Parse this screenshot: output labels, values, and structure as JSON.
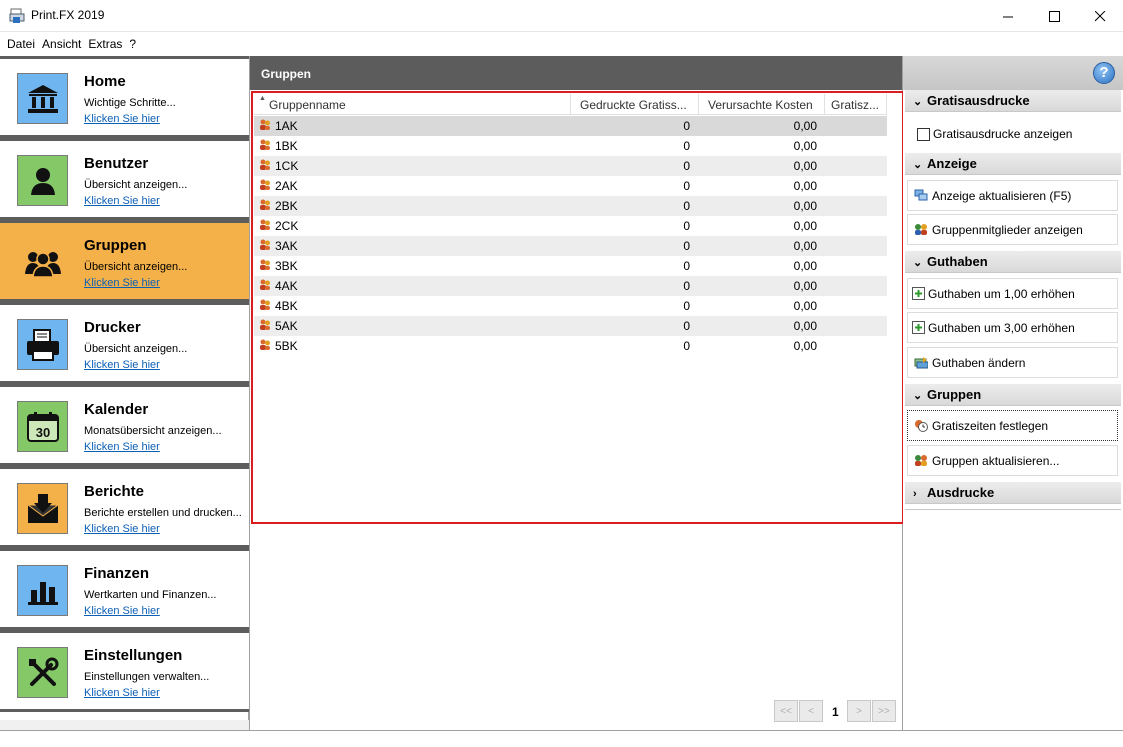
{
  "window": {
    "title": "Print.FX 2019"
  },
  "menu": [
    "Datei",
    "Ansicht",
    "Extras",
    "?"
  ],
  "nav": [
    {
      "title": "Home",
      "desc": "Wichtige Schritte...",
      "link": "Klicken Sie hier",
      "icon": "bank-icon"
    },
    {
      "title": "Benutzer",
      "desc": "Übersicht anzeigen...",
      "link": "Klicken Sie hier",
      "icon": "user-icon"
    },
    {
      "title": "Gruppen",
      "desc": "Übersicht anzeigen...",
      "link": "Klicken Sie hier",
      "icon": "group-icon"
    },
    {
      "title": "Drucker",
      "desc": "Übersicht anzeigen...",
      "link": "Klicken Sie hier",
      "icon": "printer-icon"
    },
    {
      "title": "Kalender",
      "desc": "Monatsübersicht anzeigen...",
      "link": "Klicken Sie hier",
      "icon": "calendar-icon",
      "calendar_day": "30"
    },
    {
      "title": "Berichte",
      "desc": "Berichte erstellen und drucken...",
      "link": "Klicken Sie hier",
      "icon": "report-icon"
    },
    {
      "title": "Finanzen",
      "desc": "Wertkarten und Finanzen...",
      "link": "Klicken Sie hier",
      "icon": "chart-icon"
    },
    {
      "title": "Einstellungen",
      "desc": "Einstellungen verwalten...",
      "link": "Klicken Sie hier",
      "icon": "tools-icon"
    }
  ],
  "active_nav": "Gruppen",
  "main": {
    "header": "Gruppen",
    "columns": [
      "Gruppenname",
      "Gedruckte Gratiss...",
      "Verursachte Kosten",
      "Gratisz..."
    ],
    "rows": [
      {
        "name": "1AK",
        "printed": "0",
        "cost": "0,00"
      },
      {
        "name": "1BK",
        "printed": "0",
        "cost": "0,00"
      },
      {
        "name": "1CK",
        "printed": "0",
        "cost": "0,00"
      },
      {
        "name": "2AK",
        "printed": "0",
        "cost": "0,00"
      },
      {
        "name": "2BK",
        "printed": "0",
        "cost": "0,00"
      },
      {
        "name": "2CK",
        "printed": "0",
        "cost": "0,00"
      },
      {
        "name": "3AK",
        "printed": "0",
        "cost": "0,00"
      },
      {
        "name": "3BK",
        "printed": "0",
        "cost": "0,00"
      },
      {
        "name": "4AK",
        "printed": "0",
        "cost": "0,00"
      },
      {
        "name": "4BK",
        "printed": "0",
        "cost": "0,00"
      },
      {
        "name": "5AK",
        "printed": "0",
        "cost": "0,00"
      },
      {
        "name": "5BK",
        "printed": "0",
        "cost": "0,00"
      }
    ],
    "pager": {
      "first": "<<",
      "prev": "<",
      "page": "1",
      "next": ">",
      "last": ">>"
    }
  },
  "right": {
    "help": "?",
    "sections": {
      "gratis": {
        "title": "Gratisausdrucke",
        "checkbox_label": "Gratisausdrucke anzeigen",
        "checked": false
      },
      "anzeige": {
        "title": "Anzeige",
        "buttons": [
          "Anzeige aktualisieren (F5)",
          "Gruppenmitglieder anzeigen"
        ]
      },
      "guthaben": {
        "title": "Guthaben",
        "buttons": [
          "Guthaben um 1,00 erhöhen",
          "Guthaben um 3,00 erhöhen",
          "Guthaben ändern"
        ]
      },
      "gruppen": {
        "title": "Gruppen",
        "buttons": [
          "Gratiszeiten festlegen",
          "Gruppen aktualisieren..."
        ]
      },
      "ausdrucke": {
        "title": "Ausdrucke"
      }
    }
  },
  "colors": {
    "active_nav": "#f5b149",
    "header_dark": "#5c5c5c",
    "selection_border": "#d81e1e",
    "link": "#0b5fb5"
  }
}
